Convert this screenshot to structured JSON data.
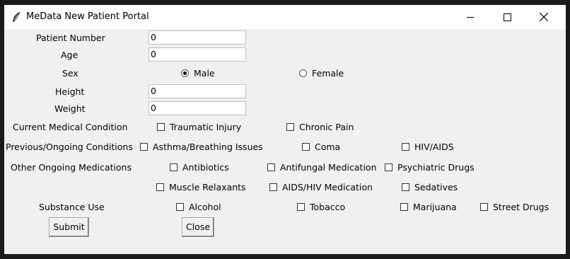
{
  "window": {
    "title": "MeData New Patient Portal",
    "icon": "feather-icon"
  },
  "fields": {
    "patient_number": {
      "label": "Patient Number",
      "value": "0"
    },
    "age": {
      "label": "Age",
      "value": "0"
    },
    "height": {
      "label": "Height",
      "value": "0"
    },
    "weight": {
      "label": "Weight",
      "value": "0"
    }
  },
  "sex": {
    "label": "Sex",
    "options": [
      "Male",
      "Female"
    ],
    "selected": "Male"
  },
  "current_condition": {
    "label": "Current Medical Condition",
    "options": [
      "Traumatic Injury",
      "Chronic Pain"
    ]
  },
  "previous_conditions": {
    "label": "Previous/Ongoing Conditions",
    "options": [
      "Asthma/Breathing Issues",
      "Coma",
      "HIV/AIDS"
    ]
  },
  "medications": {
    "label": "Other Ongoing Medications",
    "options": [
      "Antibiotics",
      "Antifungal Medication",
      "Psychiatric Drugs",
      "Muscle Relaxants",
      "AIDS/HIV Medication",
      "Sedatives"
    ]
  },
  "substance_use": {
    "label": "Substance Use",
    "options": [
      "Alcohol",
      "Tobacco",
      "Marijuana",
      "Street Drugs"
    ]
  },
  "buttons": {
    "submit": "Submit",
    "close": "Close"
  }
}
